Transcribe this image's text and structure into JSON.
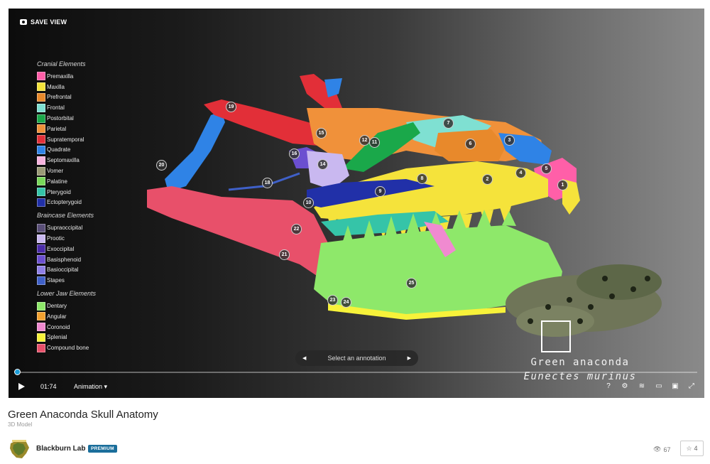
{
  "viewer": {
    "save_view_label": "SAVE VIEW",
    "legend": [
      {
        "title": "Cranial Elements",
        "items": [
          {
            "label": "Premaxilla",
            "color": "#ff5fa8"
          },
          {
            "label": "Maxilla",
            "color": "#f5e33b"
          },
          {
            "label": "Prefrontal",
            "color": "#e8892b"
          },
          {
            "label": "Frontal",
            "color": "#7fe0d2"
          },
          {
            "label": "Postorbital",
            "color": "#1aa84a"
          },
          {
            "label": "Parietal",
            "color": "#f0913a"
          },
          {
            "label": "Supratemporal",
            "color": "#e22f38"
          },
          {
            "label": "Quadrate",
            "color": "#2f83e6"
          },
          {
            "label": "Septomaxilla",
            "color": "#f6b3dd"
          },
          {
            "label": "Vomer",
            "color": "#9a9a76"
          },
          {
            "label": "Palatine",
            "color": "#78d85a"
          },
          {
            "label": "Pterygoid",
            "color": "#35c4a8"
          },
          {
            "label": "Ectopterygoid",
            "color": "#2130a8"
          }
        ]
      },
      {
        "title": "Braincase Elements",
        "items": [
          {
            "label": "Supraoccipital",
            "color": "#5a4f78"
          },
          {
            "label": "Prootic",
            "color": "#c9b8f0"
          },
          {
            "label": "Exoccipital",
            "color": "#4a2ba8"
          },
          {
            "label": "Basisphenoid",
            "color": "#6b4fd0"
          },
          {
            "label": "Basioccipital",
            "color": "#8f80e6"
          },
          {
            "label": "Stapes",
            "color": "#3f60c8"
          }
        ]
      },
      {
        "title": "Lower Jaw Elements",
        "items": [
          {
            "label": "Dentary",
            "color": "#8ee86a"
          },
          {
            "label": "Angular",
            "color": "#f3a230"
          },
          {
            "label": "Coronoid",
            "color": "#f08ad0"
          },
          {
            "label": "Splenial",
            "color": "#f7f23a"
          },
          {
            "label": "Compound bone",
            "color": "#e8506a"
          }
        ]
      }
    ],
    "annotations": [
      "1",
      "2",
      "3",
      "4",
      "5",
      "6",
      "7",
      "8",
      "9",
      "10",
      "11",
      "12",
      "14",
      "15",
      "16",
      "18",
      "19",
      "20",
      "21",
      "22",
      "23",
      "24",
      "25"
    ],
    "annotation_nav": {
      "prev_icon": "◀",
      "label": "Select an annotation",
      "next_icon": "▶"
    },
    "species": {
      "common": "Green anaconda",
      "scientific": "Eunectes murinus"
    },
    "controls": {
      "time": "01:74",
      "animation_label": "Animation ▾",
      "progress": 0.0,
      "icons": [
        "help-icon",
        "settings-icon",
        "layers-icon",
        "vr-icon",
        "theater-icon",
        "fullscreen-icon"
      ]
    }
  },
  "model": {
    "title": "Green Anaconda Skull Anatomy",
    "subtitle": "3D Model",
    "author": "Blackburn Lab",
    "badge": "PREMIUM",
    "views": "67",
    "likes": "4"
  }
}
